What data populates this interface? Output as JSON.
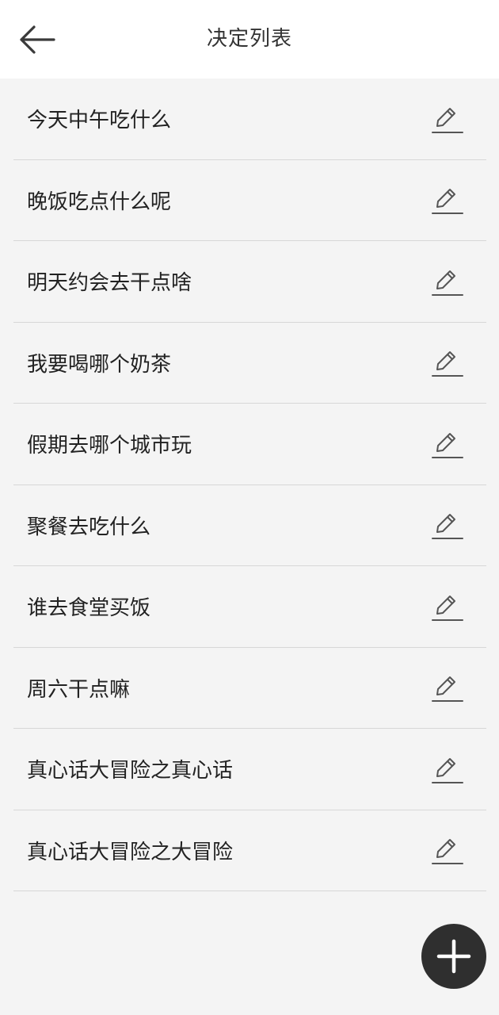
{
  "header": {
    "title": "决定列表",
    "back_icon": "arrow-left-icon"
  },
  "list": {
    "items": [
      {
        "label": "今天中午吃什么",
        "action_icon": "pencil-edit-icon"
      },
      {
        "label": "晚饭吃点什么呢",
        "action_icon": "pencil-edit-icon"
      },
      {
        "label": "明天约会去干点啥",
        "action_icon": "pencil-edit-icon"
      },
      {
        "label": "我要喝哪个奶茶",
        "action_icon": "pencil-edit-icon"
      },
      {
        "label": "假期去哪个城市玩",
        "action_icon": "pencil-edit-icon"
      },
      {
        "label": "聚餐去吃什么",
        "action_icon": "pencil-edit-icon"
      },
      {
        "label": "谁去食堂买饭",
        "action_icon": "pencil-edit-icon"
      },
      {
        "label": "周六干点嘛",
        "action_icon": "pencil-edit-icon"
      },
      {
        "label": "真心话大冒险之真心话",
        "action_icon": "pencil-edit-icon"
      },
      {
        "label": "真心话大冒险之大冒险",
        "action_icon": "pencil-edit-icon"
      }
    ]
  },
  "fab": {
    "icon": "plus-icon",
    "color": "#2f2f2f"
  },
  "colors": {
    "background": "#f4f4f4",
    "header_background": "#ffffff",
    "divider": "#d7d7d7",
    "text": "#222222"
  }
}
